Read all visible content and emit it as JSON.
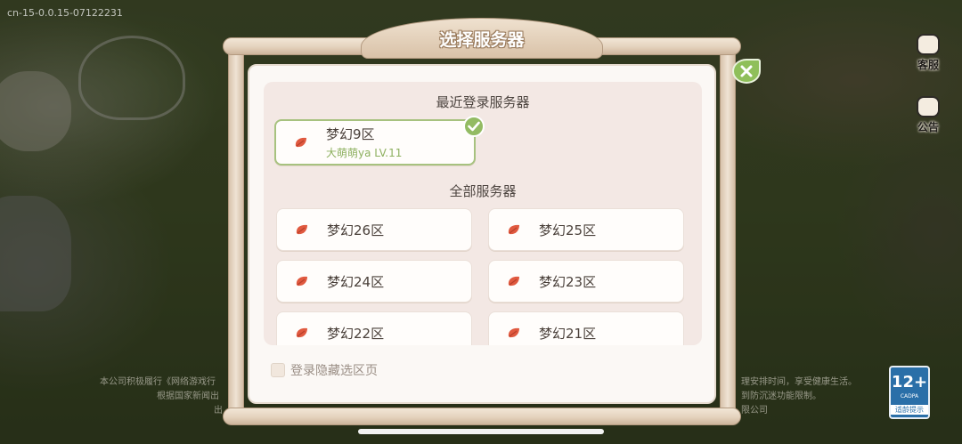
{
  "version_label": "cn-15-0.0.15-07122231",
  "dialog": {
    "title": "选择服务器",
    "recent_section_title": "最近登录服务器",
    "recent_server": {
      "name": "梦幻9区",
      "player": "大萌萌ya  LV.11",
      "selected": true
    },
    "all_section_title": "全部服务器",
    "servers": [
      {
        "name": "梦幻26区"
      },
      {
        "name": "梦幻25区"
      },
      {
        "name": "梦幻24区"
      },
      {
        "name": "梦幻23区"
      },
      {
        "name": "梦幻22区"
      },
      {
        "name": "梦幻21区"
      }
    ],
    "hide_page_label": "登录隐藏选区页",
    "hide_page_checked": false
  },
  "side_buttons": {
    "service_label": "客服",
    "notice_label": "公告"
  },
  "age_rating": {
    "age": "12+",
    "org": "CADPA",
    "tip": "适龄提示"
  },
  "notice_fragments": {
    "left_line1": "本公司积极履行《网络游戏行",
    "left_line2": "根据国家新闻出",
    "left_line3": "出",
    "right_line1": "理安排时间，享受健康生活。",
    "right_line2": "到防沉迷功能限制。",
    "right_line3": "限公司"
  },
  "colors": {
    "accent_green": "#8fbf5a",
    "board_wood": "#e4d2bd",
    "panel_bg": "#f3e8e4"
  },
  "icons": {
    "server_icon": "red-leaf-icon",
    "close": "close-icon",
    "check": "check-icon"
  }
}
